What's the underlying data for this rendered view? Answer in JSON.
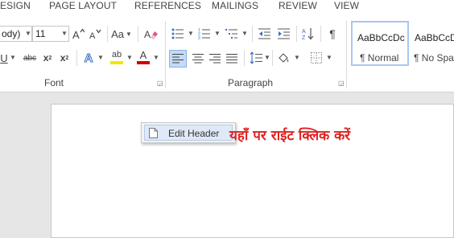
{
  "tabs": [
    "ESIGN",
    "PAGE LAYOUT",
    "REFERENCES",
    "MAILINGS",
    "REVIEW",
    "VIEW"
  ],
  "font": {
    "name_value": "ody)",
    "size_value": "11",
    "grow_icon": "A^",
    "shrink_icon": "Av",
    "change_case": "Aa",
    "underline": "U",
    "strike": "abc",
    "subscript_base": "x",
    "subscript_mark": "2",
    "superscript_base": "x",
    "superscript_mark": "2",
    "text_effects": "A",
    "highlight": "ab",
    "font_color": "A",
    "group_label": "Font"
  },
  "paragraph": {
    "pilcrow": "¶",
    "group_label": "Paragraph"
  },
  "styles": [
    {
      "preview": "AaBbCcDc",
      "name": "¶ Normal"
    },
    {
      "preview": "AaBbCcDc",
      "name": "¶ No Spac"
    }
  ],
  "context_menu": {
    "item": "Edit Header"
  },
  "annotation": "यहाँ पर राईट क्लिक करें",
  "colors": {
    "highlight": "#f5e500",
    "font_color": "#d40000",
    "annotation": "#e02020",
    "selected_style_border": "#a9c7ee"
  }
}
